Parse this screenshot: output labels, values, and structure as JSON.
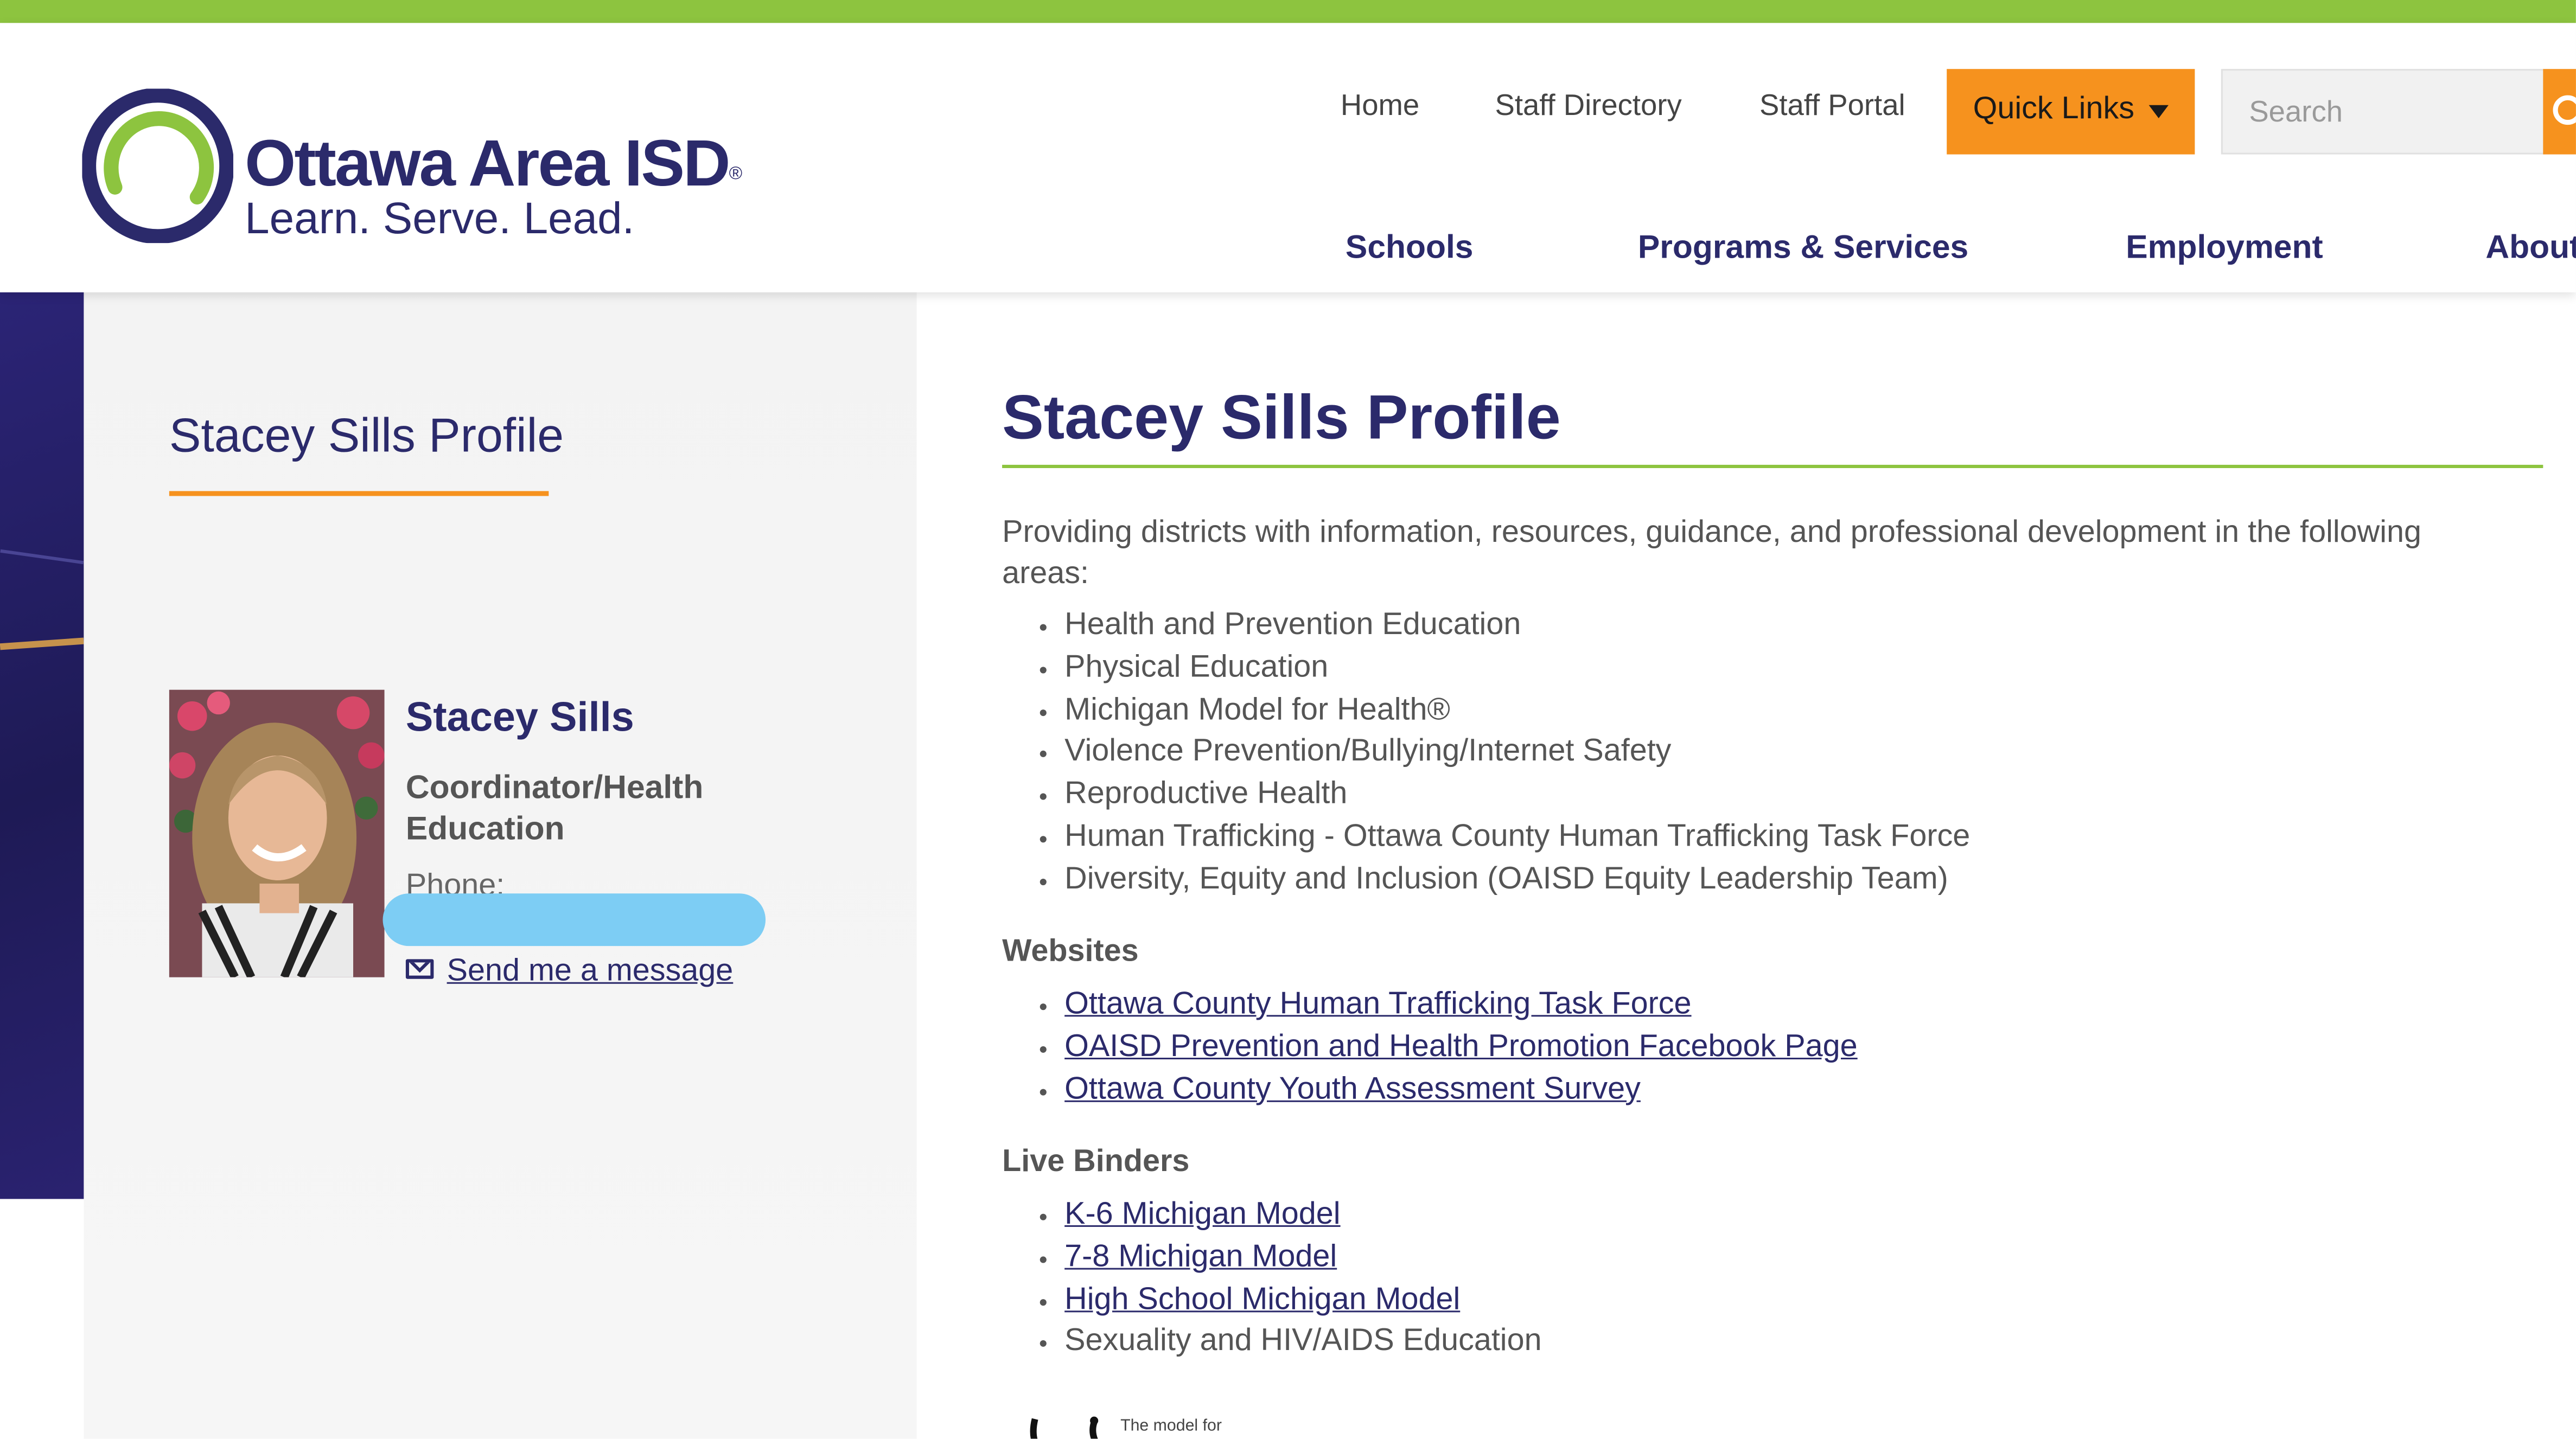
{
  "header": {
    "logo_name": "Ottawa Area ISD",
    "logo_reg": "®",
    "logo_tagline": "Learn. Serve. Lead.",
    "utility_links": [
      "Home",
      "Staff Directory",
      "Staff Portal"
    ],
    "quick_links_label": "Quick Links",
    "search_placeholder": "Search",
    "main_nav": [
      "Schools",
      "Programs & Services",
      "Employment",
      "About"
    ],
    "colors": {
      "accent_green": "#8dc43f",
      "accent_orange": "#f6921e",
      "brand_navy": "#2b2a6b"
    }
  },
  "sidebar": {
    "title": "Stacey Sills Profile",
    "profile": {
      "name": "Stacey Sills",
      "title": "Coordinator/Health Education",
      "phone_label": "Phone:",
      "message_link": "Send me a message"
    }
  },
  "main": {
    "heading": "Stacey Sills Profile",
    "intro": "Providing districts with information, resources, guidance, and professional development in the following areas:",
    "areas": [
      "Health and Prevention Education",
      "Physical Education",
      "Michigan Model for Health®",
      "Violence Prevention/Bullying/Internet Safety",
      "Reproductive Health",
      "Human Trafficking - Ottawa County Human Trafficking Task Force",
      "Diversity, Equity and Inclusion (OAISD Equity Leadership Team)"
    ],
    "websites_heading": "Websites",
    "websites": [
      "Ottawa County Human Trafficking Task Force",
      "OAISD Prevention and Health Promotion Facebook Page",
      "Ottawa County Youth Assessment Survey"
    ],
    "binders_heading": "Live Binders",
    "binders": [
      "K-6 Michigan Model",
      "7-8 Michigan Model",
      "High School Michigan Model",
      "Sexuality and HIV/AIDS Education"
    ],
    "partial_image_text": "The model for"
  }
}
